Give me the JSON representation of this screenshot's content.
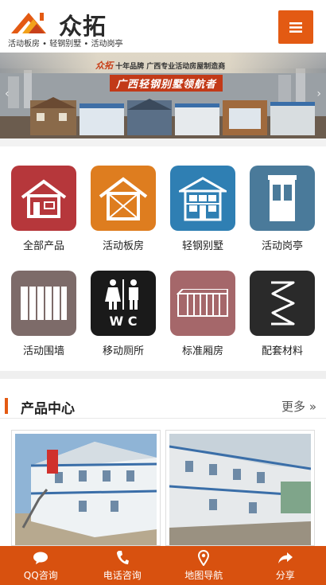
{
  "header": {
    "brand_name": "众拓",
    "tagline": "活动板房 • 轻钢别墅 • 活动岗亭",
    "menu_icon": "hamburger-icon",
    "accent": "#e35a13"
  },
  "banner": {
    "brand": "众拓",
    "slogan_prefix": "十年品牌",
    "slogan_main": "广西专业活动房屋制造商",
    "headline": "广西轻钢别墅领航者"
  },
  "categories": [
    {
      "label": "全部产品",
      "icon": "house-outline-icon",
      "color": "#b6373b"
    },
    {
      "label": "活动板房",
      "icon": "house-frame-icon",
      "color": "#de7d1f"
    },
    {
      "label": "轻钢别墅",
      "icon": "villa-icon",
      "color": "#2f7fb3"
    },
    {
      "label": "活动岗亭",
      "icon": "guard-booth-icon",
      "color": "#4a7a9a"
    },
    {
      "label": "活动围墙",
      "icon": "fence-wall-icon",
      "color": "#7d6b69"
    },
    {
      "label": "移动厕所",
      "icon": "toilet-wc-icon",
      "color": "#1a1a1a"
    },
    {
      "label": "标准厢房",
      "icon": "container-room-icon",
      "color": "#a5676a"
    },
    {
      "label": "配套材料",
      "icon": "spring-material-icon",
      "color": "#2a2a2a"
    }
  ],
  "product_section": {
    "title": "产品中心",
    "more": "更多 »"
  },
  "products": [
    {
      "name": "two-storey-prefab-house-1"
    },
    {
      "name": "two-storey-prefab-house-2"
    }
  ],
  "bottom_nav": [
    {
      "label": "QQ咨询",
      "icon": "chat-bubble-icon"
    },
    {
      "label": "电话咨询",
      "icon": "phone-icon"
    },
    {
      "label": "地图导航",
      "icon": "map-pin-icon"
    },
    {
      "label": "分享",
      "icon": "share-arrow-icon"
    }
  ]
}
